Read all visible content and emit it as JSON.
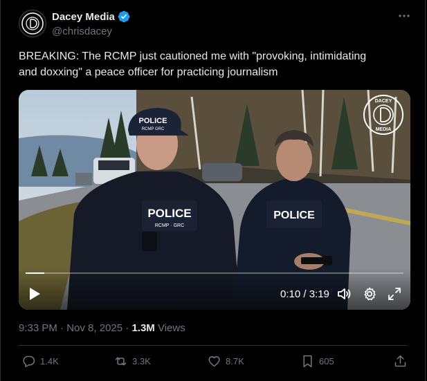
{
  "author": {
    "name": "Dacey Media",
    "handle": "@chrisdacey",
    "avatar_text_top": "DACEY",
    "avatar_text_bottom": "MEDIA"
  },
  "tweet": {
    "text_line1": "BREAKING: The RCMP just cautioned me with \"provoking, intimidating",
    "text_line2": "and doxxing\" a peace officer for practicing journalism"
  },
  "video": {
    "current_time": "0:10",
    "duration": "3:19",
    "time_display": "0:10 / 3:19",
    "progress_fraction": 0.05,
    "watermark_top": "DACEY",
    "watermark_bottom": "MEDIA",
    "vest_label": "POLICE",
    "vest_sub": "RCMP · GRC",
    "cap_label": "POLICE",
    "cap_sub": "RCMP GRC"
  },
  "meta": {
    "time": "9:33 PM",
    "date": "Nov 8, 2025",
    "views_count": "1.3M",
    "views_label": "Views"
  },
  "actions": {
    "replies": "1.4K",
    "reposts": "3.3K",
    "likes": "8.7K",
    "bookmarks": "605"
  },
  "colors": {
    "background": "#000000",
    "text": "#e7e9ea",
    "secondary": "#71767b",
    "verified": "#1d9bf0",
    "divider": "#2f3336"
  }
}
